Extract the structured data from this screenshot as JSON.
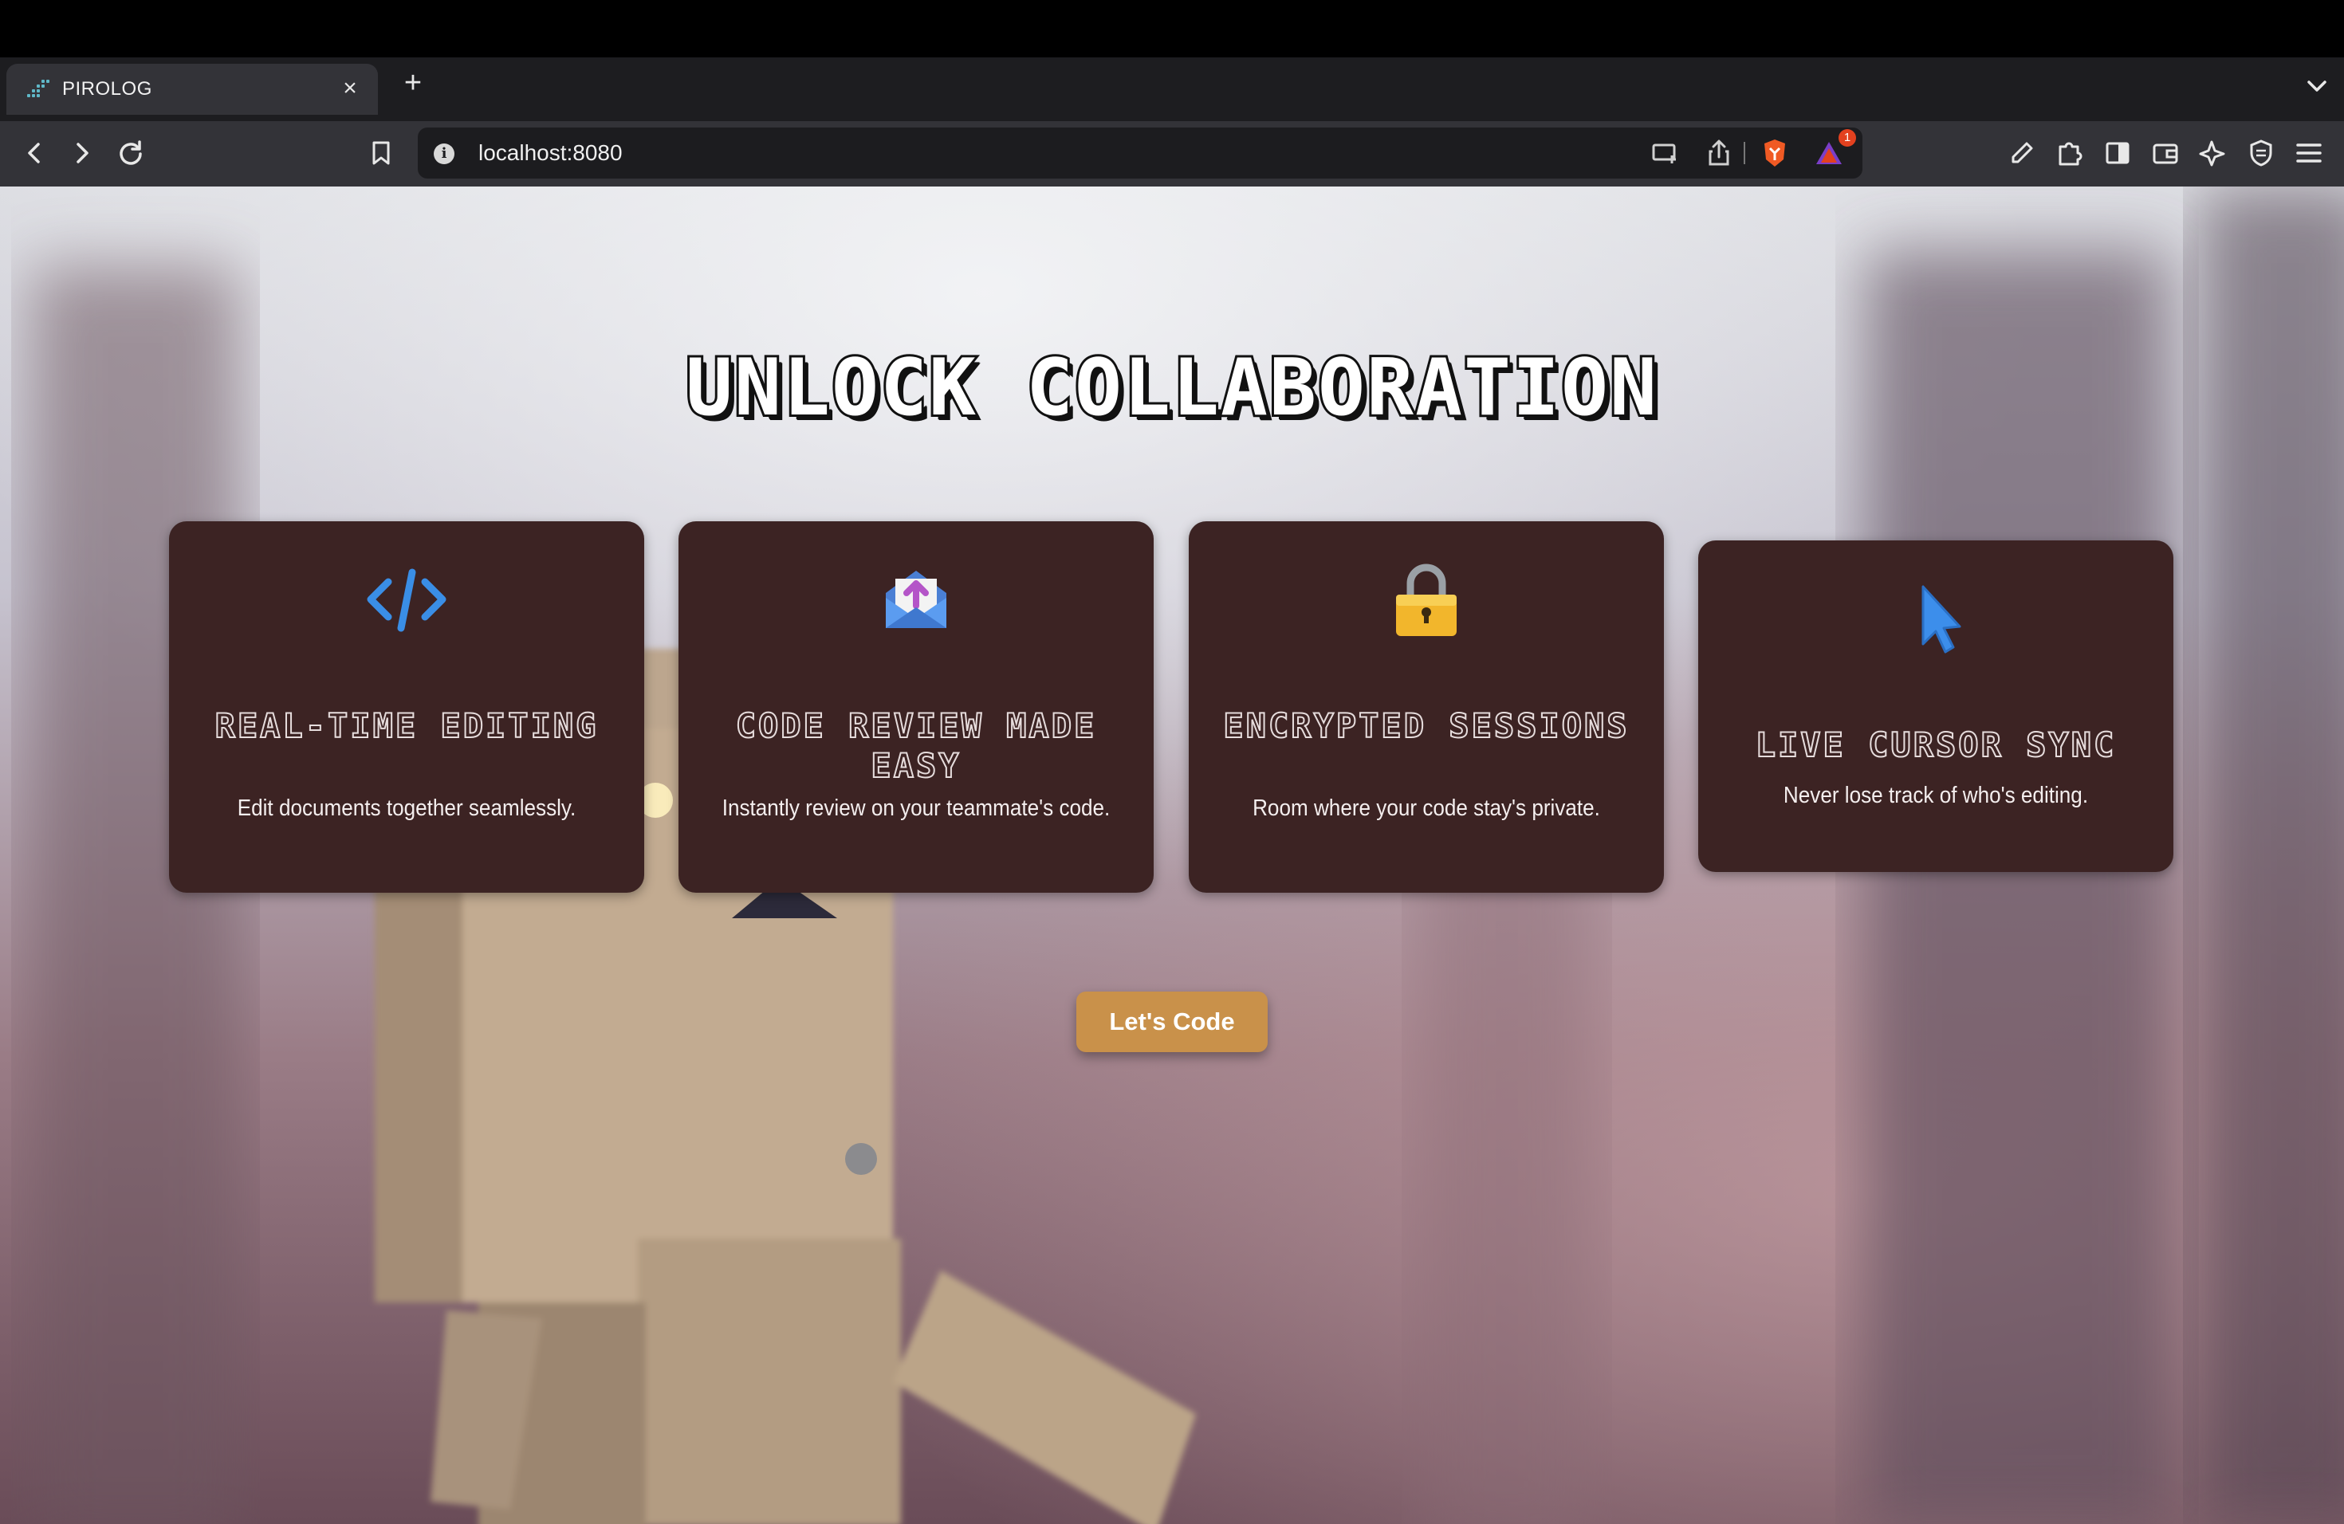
{
  "browser": {
    "tab": {
      "title": "PIROLOG",
      "close_label": "×"
    },
    "new_tab_label": "+",
    "url": "localhost:8080",
    "notification_count": "1"
  },
  "page": {
    "hero_title": "UNLOCK COLLABORATION",
    "features": [
      {
        "icon": "code-icon",
        "title": "REAL-TIME EDITING",
        "description": "Edit documents together seamlessly."
      },
      {
        "icon": "envelope-icon",
        "title": "CODE REVIEW MADE EASY",
        "description": "Instantly review on your teammate's code."
      },
      {
        "icon": "lock-icon",
        "title": "ENCRYPTED SESSIONS",
        "description": "Room where your code stay's private."
      },
      {
        "icon": "cursor-icon",
        "title": "LIVE CURSOR SYNC",
        "description": "Never lose track of who's editing."
      }
    ],
    "cta_label": "Let's Code"
  },
  "colors": {
    "card_bg": "#3c2323",
    "cta_bg": "#c9914a",
    "chrome_bg": "#333338"
  }
}
